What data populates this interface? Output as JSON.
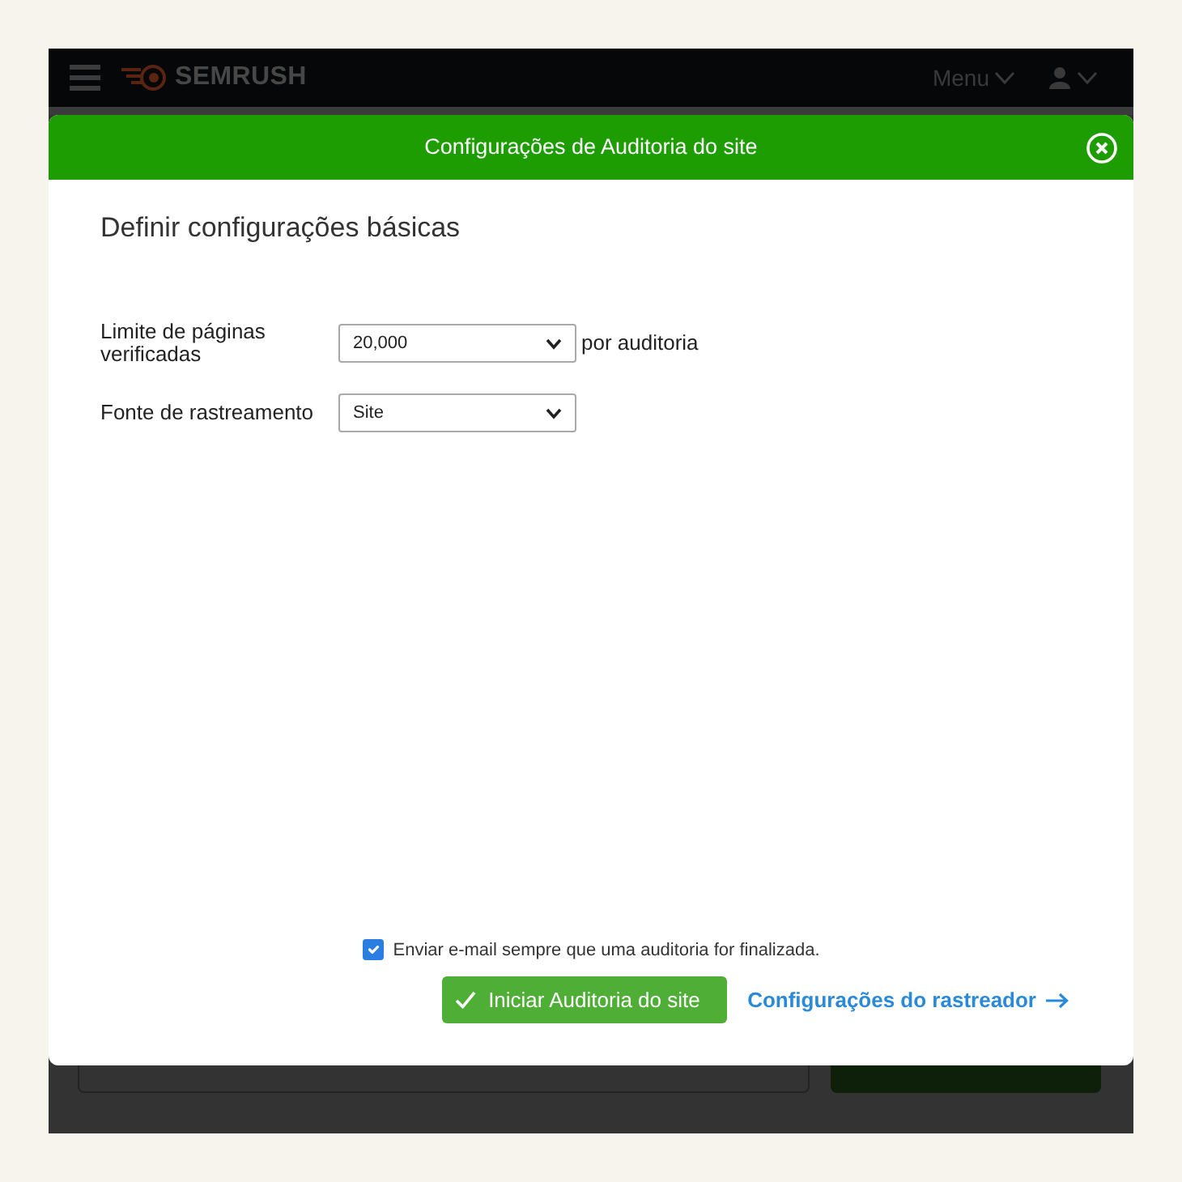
{
  "navbar": {
    "logo_text": "SEMRUSH",
    "menu_label": "Menu"
  },
  "dialog": {
    "title": "Configurações de Auditoria do site",
    "heading": "Definir configurações básicas",
    "fields": [
      {
        "label": "Limite de páginas verificadas",
        "value": "20,000",
        "suffix": "por auditoria"
      },
      {
        "label": "Fonte de rastreamento",
        "value": "Site"
      }
    ],
    "email_option": {
      "label": "Enviar e-mail sempre que uma auditoria for finalizada.",
      "checked": true
    },
    "start_button": {
      "label": "Iniciar Auditoria do site"
    },
    "crawler_link": {
      "label": "Configurações do rastreador"
    }
  }
}
